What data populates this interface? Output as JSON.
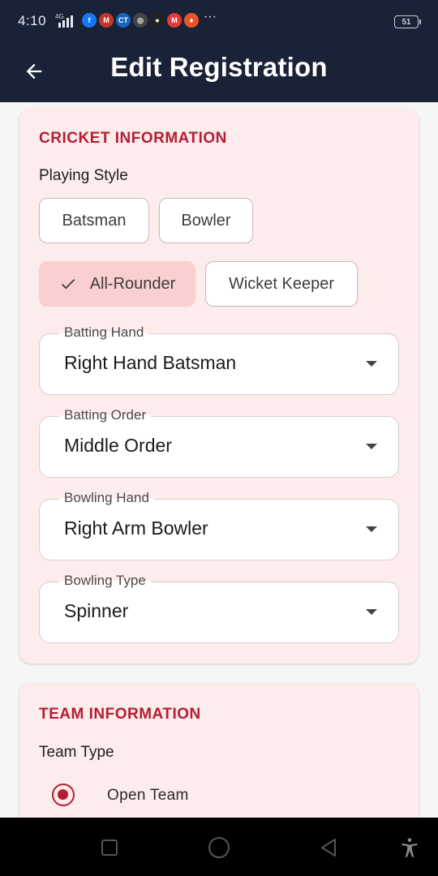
{
  "status_bar": {
    "time": "4:10",
    "network": "4G",
    "battery": "51",
    "more": "···",
    "notifications": [
      {
        "name": "facebook-icon",
        "glyph": "f",
        "color": "#1877f2"
      },
      {
        "name": "app-icon-m1",
        "glyph": "M",
        "color": "#c0392b"
      },
      {
        "name": "ct-icon",
        "glyph": "CT",
        "color": "#1565c0"
      },
      {
        "name": "app-icon-circle",
        "glyph": "◎",
        "color": "#444444"
      },
      {
        "name": "app-icon-dot",
        "glyph": "●",
        "color": "#222222"
      },
      {
        "name": "app-icon-m2",
        "glyph": "M",
        "color": "#e53935"
      },
      {
        "name": "app-icon-orange",
        "glyph": "♦",
        "color": "#e8552a"
      }
    ]
  },
  "app_bar": {
    "title": "Edit Registration",
    "back_icon": "arrow-left-icon"
  },
  "cricket_section": {
    "title": "CRICKET INFORMATION",
    "playing_style_label": "Playing Style",
    "chips": [
      {
        "label": "Batsman",
        "selected": false
      },
      {
        "label": "Bowler",
        "selected": false
      },
      {
        "label": "All-Rounder",
        "selected": true
      },
      {
        "label": "Wicket Keeper",
        "selected": false
      }
    ],
    "fields": [
      {
        "label": "Batting Hand",
        "value": "Right Hand Batsman"
      },
      {
        "label": "Batting Order",
        "value": "Middle Order"
      },
      {
        "label": "Bowling Hand",
        "value": "Right Arm Bowler"
      },
      {
        "label": "Bowling Type",
        "value": "Spinner"
      }
    ]
  },
  "team_section": {
    "title": "TEAM INFORMATION",
    "team_type_label": "Team Type",
    "options": [
      {
        "label": "Open Team",
        "selected": true
      }
    ]
  },
  "colors": {
    "app_bar": "#1a2238",
    "accent": "#b51d33",
    "card_bg": "#fdecec",
    "chip_selected": "#f9cfd0"
  }
}
